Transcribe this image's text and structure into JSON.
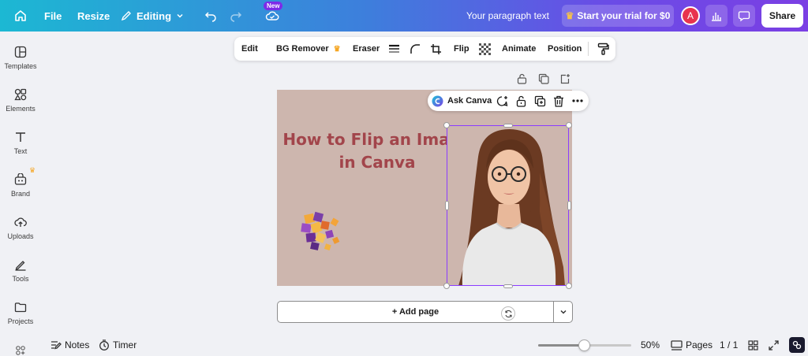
{
  "topbar": {
    "file_label": "File",
    "resize_label": "Resize",
    "editing_label": "Editing",
    "new_badge": "New",
    "doc_title": "Your paragraph text",
    "trial_label": "Start your trial for $0",
    "avatar_letter": "A",
    "share_label": "Share"
  },
  "sidebar": {
    "items": [
      {
        "label": "Templates",
        "icon": "templates-icon"
      },
      {
        "label": "Elements",
        "icon": "elements-icon"
      },
      {
        "label": "Text",
        "icon": "text-icon"
      },
      {
        "label": "Brand",
        "icon": "brand-icon"
      },
      {
        "label": "Uploads",
        "icon": "uploads-icon"
      },
      {
        "label": "Tools",
        "icon": "tools-icon"
      },
      {
        "label": "Projects",
        "icon": "projects-icon"
      }
    ]
  },
  "context_toolbar": {
    "edit": "Edit",
    "bg_remover": "BG Remover",
    "eraser": "Eraser",
    "flip": "Flip",
    "animate": "Animate",
    "position": "Position"
  },
  "canvas": {
    "title_line1": "How to Flip an Image",
    "title_line2": "in Canva",
    "background_color": "#cdb6ae",
    "title_color": "#a2454b"
  },
  "floating_toolbar": {
    "ask_canva": "Ask Canva"
  },
  "add_page_label": "+ Add page",
  "bottom": {
    "notes": "Notes",
    "timer": "Timer",
    "zoom": "50%",
    "zoom_fraction": 0.5,
    "pages_label": "Pages",
    "page_count": "1 / 1"
  },
  "colors": {
    "accent": "#8b3dff",
    "avatar": "#e8344e"
  }
}
